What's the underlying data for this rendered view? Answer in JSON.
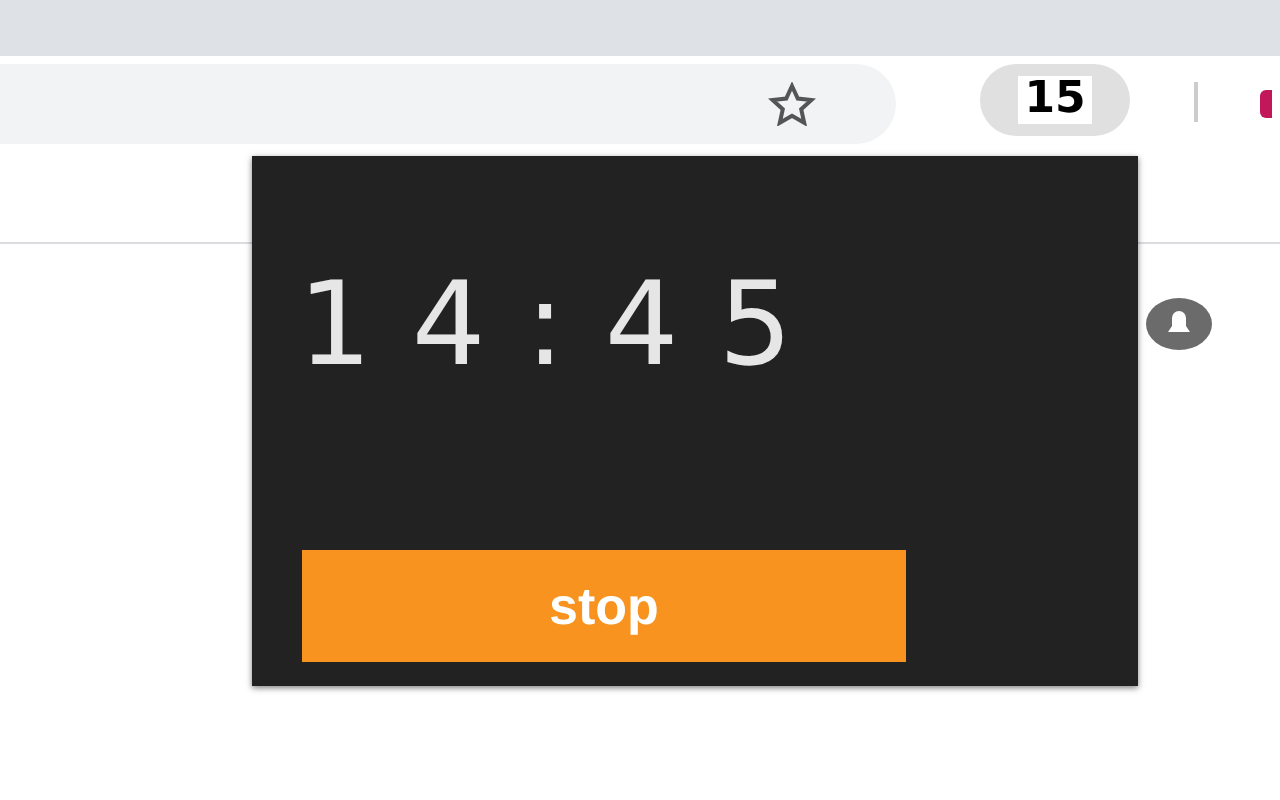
{
  "toolbar": {
    "badge": "15"
  },
  "popup": {
    "time": "14:45",
    "button": "stop"
  }
}
